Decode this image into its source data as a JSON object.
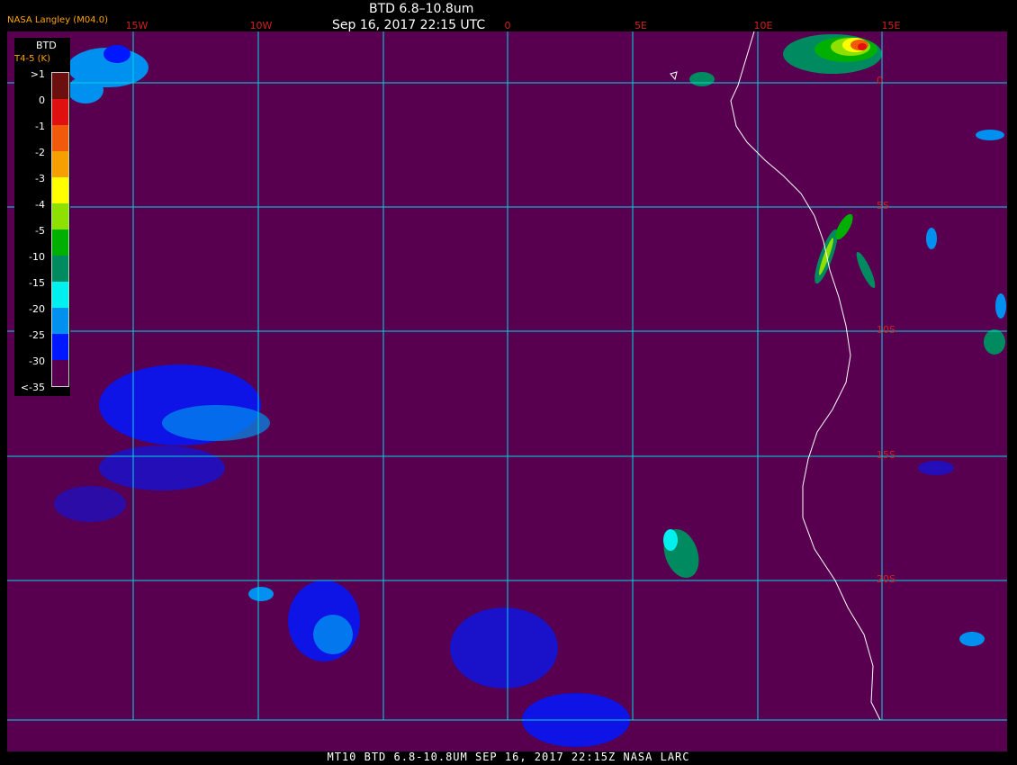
{
  "header": {
    "title": "BTD 6.8–10.8um",
    "subtitle": "Sep 16, 2017 22:15 UTC",
    "credit": "NASA Langley (M04.0)"
  },
  "footer": "MT10  BTD 6.8-10.8UM  SEP 16, 2017 22:15Z  NASA LARC",
  "longitudes": [
    "15W",
    "10W",
    "0",
    "5E",
    "10E",
    "15E"
  ],
  "latitudes": [
    "0",
    "5S",
    "10S",
    "15S",
    "20S"
  ],
  "legend": {
    "title": "BTD",
    "unit": "T4-5 (K)",
    "ticks": [
      ">1",
      "0",
      "-1",
      "-2",
      "-3",
      "-4",
      "-5",
      "-10",
      "-15",
      "-20",
      "-25",
      "-30",
      "<-35"
    ],
    "colors": [
      "#6b0f0f",
      "#e01010",
      "#f05a0a",
      "#f5a000",
      "#ffff00",
      "#8ee000",
      "#00b000",
      "#008a60",
      "#00f0f0",
      "#0090f0",
      "#0018ff",
      "#58004f"
    ]
  },
  "colors": {
    "background": "#58004f",
    "grid": "#00d8e0",
    "lon_label": "#d02020",
    "lat_label": "#d02020",
    "credit": "#ffa500",
    "coast": "#ffffff"
  }
}
